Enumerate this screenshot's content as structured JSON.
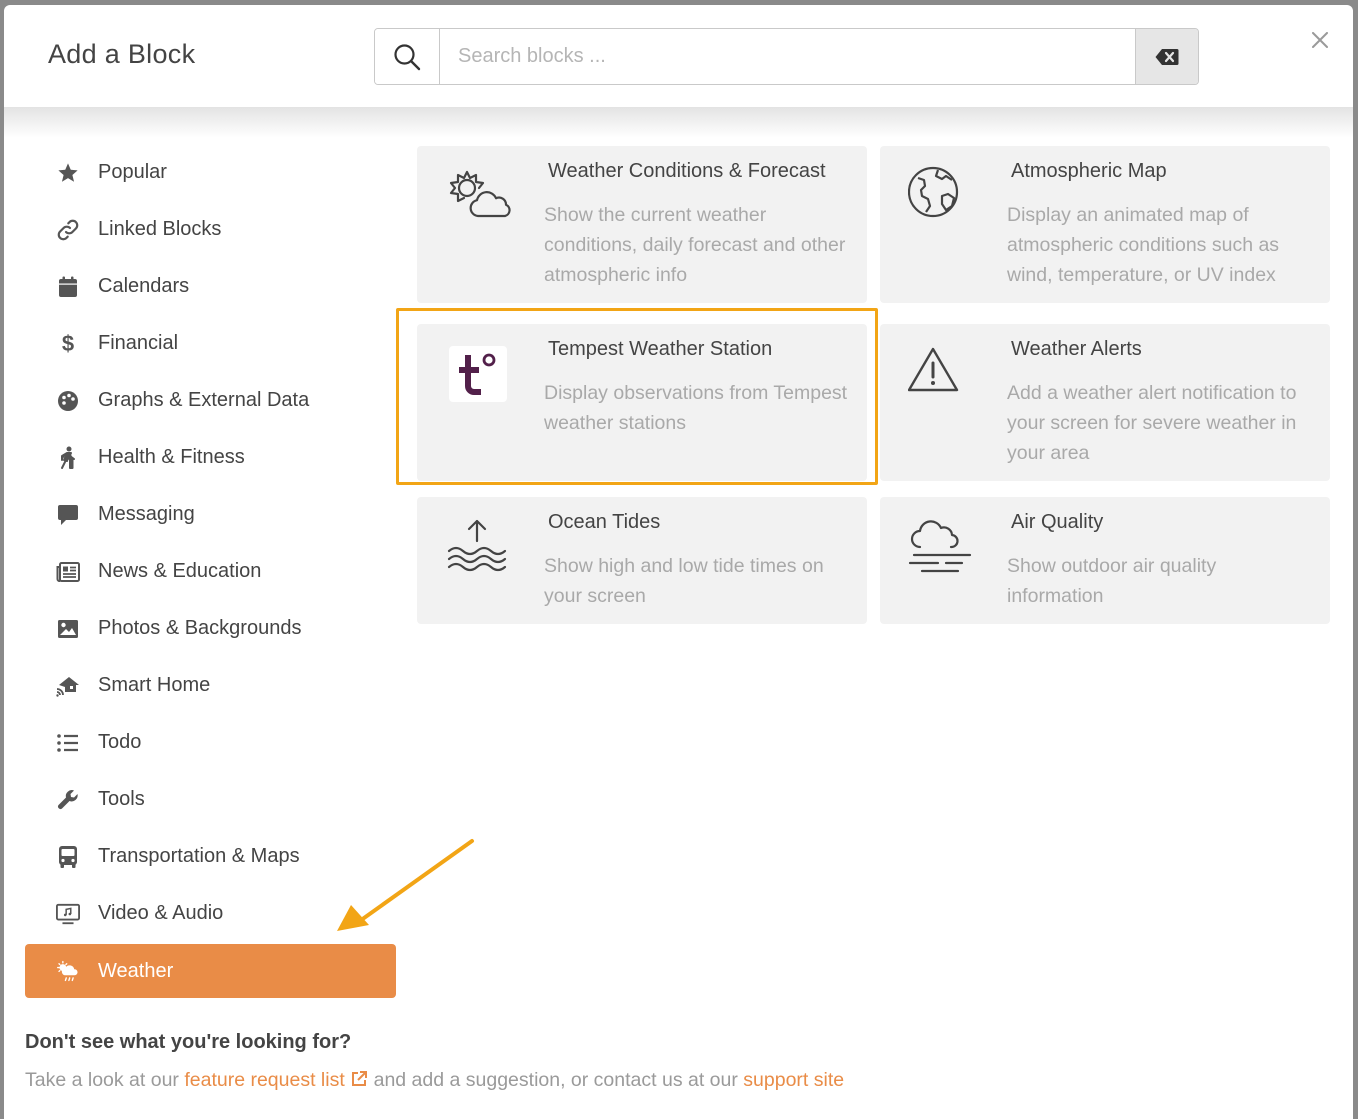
{
  "header": {
    "title": "Add a Block",
    "search_placeholder": "Search blocks ..."
  },
  "sidebar": {
    "items": [
      {
        "label": "Popular",
        "icon": "star-icon"
      },
      {
        "label": "Linked Blocks",
        "icon": "link-icon"
      },
      {
        "label": "Calendars",
        "icon": "calendar-icon"
      },
      {
        "label": "Financial",
        "icon": "dollar-icon"
      },
      {
        "label": "Graphs & External Data",
        "icon": "palette-icon"
      },
      {
        "label": "Health & Fitness",
        "icon": "walking-icon"
      },
      {
        "label": "Messaging",
        "icon": "comment-icon"
      },
      {
        "label": "News & Education",
        "icon": "newspaper-icon"
      },
      {
        "label": "Photos & Backgrounds",
        "icon": "image-icon"
      },
      {
        "label": "Smart Home",
        "icon": "smart-home-icon"
      },
      {
        "label": "Todo",
        "icon": "list-icon"
      },
      {
        "label": "Tools",
        "icon": "wrench-icon"
      },
      {
        "label": "Transportation & Maps",
        "icon": "bus-icon"
      },
      {
        "label": "Video & Audio",
        "icon": "monitor-music-icon"
      },
      {
        "label": "Weather",
        "icon": "cloud-sun-rain-icon",
        "active": true
      }
    ]
  },
  "blocks": [
    {
      "title": "Weather Conditions & Forecast",
      "desc": "Show the current weather conditions, daily forecast and other atmospheric info",
      "icon": "sun-cloud-icon"
    },
    {
      "title": "Atmospheric Map",
      "desc": "Display an animated map of atmospheric conditions such as wind, temperature, or UV index",
      "icon": "globe-icon"
    },
    {
      "title": "Tempest Weather Station",
      "desc": "Display observations from Tempest weather stations",
      "icon": "tempest-logo-icon"
    },
    {
      "title": "Weather Alerts",
      "desc": "Add a weather alert notification to your screen for severe weather in your area",
      "icon": "warning-triangle-icon"
    },
    {
      "title": "Ocean Tides",
      "desc": "Show high and low tide times on your screen",
      "icon": "tide-icon"
    },
    {
      "title": "Air Quality",
      "desc": "Show outdoor air quality information",
      "icon": "cloud-fog-icon"
    }
  ],
  "footer": {
    "question": "Don't see what you're looking for?",
    "text_before": "Take a look at our ",
    "link1": "feature request list",
    "text_middle": " and add a suggestion, or contact us at our ",
    "link2": "support site"
  },
  "colors": {
    "accent": "#e98c47",
    "highlight": "#f2a516"
  }
}
